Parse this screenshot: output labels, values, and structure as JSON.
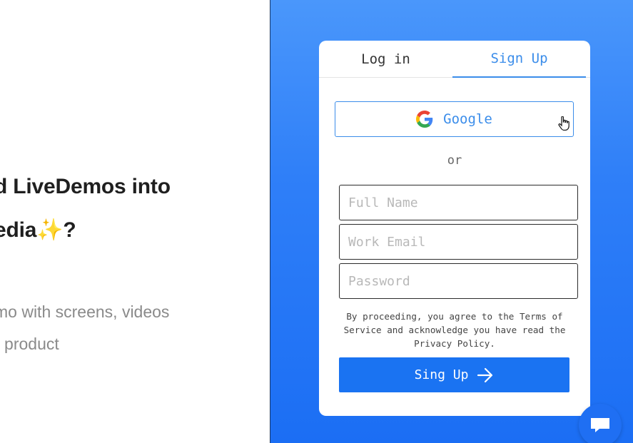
{
  "hero": {
    "headline_line1": "d LiveDemos into",
    "headline_line2": "edia",
    "headline_emoji": "✨",
    "headline_end": "?",
    "subtitle_line1": "mo with screens, videos",
    "subtitle_line2": "r product"
  },
  "auth": {
    "tabs": [
      {
        "label": "Log in",
        "active": false
      },
      {
        "label": "Sign Up",
        "active": true
      }
    ],
    "google_label": "Google",
    "divider": "or",
    "fields": {
      "full_name_placeholder": "Full Name",
      "email_placeholder": "Work Email",
      "password_placeholder": "Password"
    },
    "terms": "By proceeding, you agree to the Terms of Service and acknowledge you have read the Privacy Policy.",
    "submit_label": "Sing Up"
  },
  "icons": {
    "google": "google-logo-icon",
    "arrow": "arrow-right-icon",
    "chat": "chat-bubble-icon",
    "cursor": "hand-pointer-icon"
  },
  "colors": {
    "accent": "#3b8dea",
    "button": "#1a73f2",
    "panel_top": "#4a97fb",
    "panel_bottom": "#1b6ef4"
  }
}
